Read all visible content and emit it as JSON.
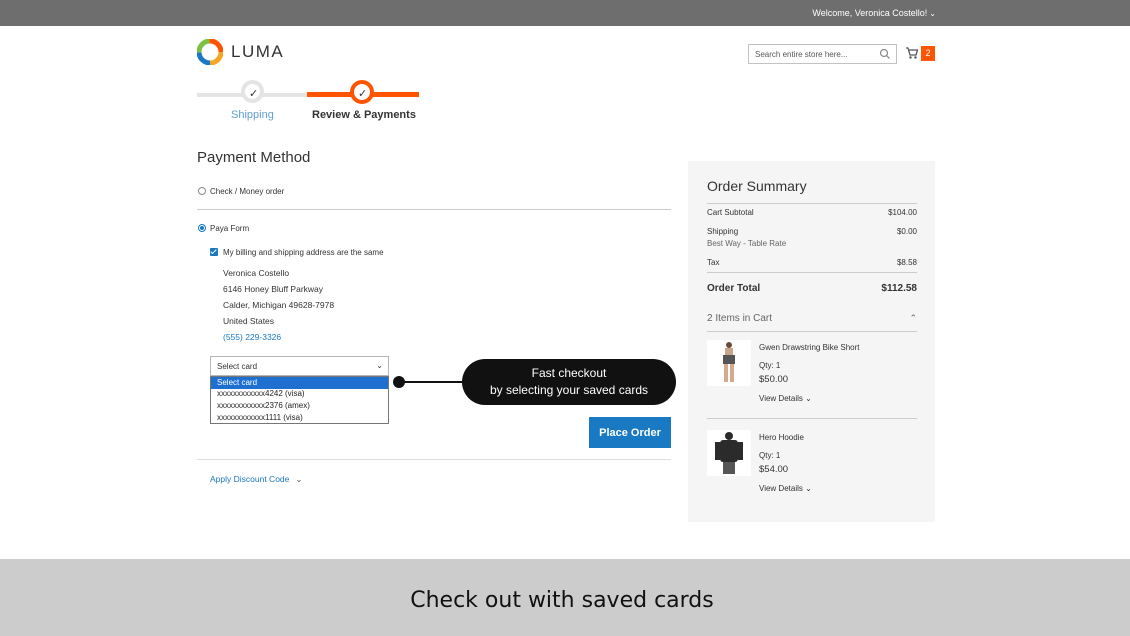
{
  "header": {
    "welcome": "Welcome, Veronica Costello!",
    "logo_text": "LUMA",
    "search_placeholder": "Search entire store here...",
    "cart_count": "2"
  },
  "progress": {
    "steps": [
      {
        "label": "Shipping"
      },
      {
        "label": "Review & Payments"
      }
    ]
  },
  "payment": {
    "title": "Payment Method",
    "methods": [
      {
        "label": "Check / Money order",
        "checked": false
      },
      {
        "label": "Paya Form",
        "checked": true
      }
    ],
    "same_address_label": "My billing and shipping address are the same",
    "address": [
      "Veronica Costello",
      "6146 Honey Bluff Parkway",
      "Calder, Michigan 49628-7978",
      "United States"
    ],
    "phone": "(555) 229-3326",
    "select_value": "Select card",
    "card_options": [
      "Select card",
      "xxxxxxxxxxxx4242 (visa)",
      "xxxxxxxxxxxx2376 (amex)",
      "xxxxxxxxxxxx1111 (visa)"
    ],
    "place_order": "Place Order",
    "discount_label": "Apply Discount Code"
  },
  "callout": {
    "line1": "Fast checkout",
    "line2": "by selecting your saved cards"
  },
  "summary": {
    "title": "Order Summary",
    "subtotal_label": "Cart Subtotal",
    "subtotal": "$104.00",
    "shipping_label": "Shipping",
    "shipping_method": "Best Way - Table Rate",
    "shipping": "$0.00",
    "tax_label": "Tax",
    "tax": "$8.58",
    "total_label": "Order Total",
    "total": "$112.58",
    "items_label": "2 Items in Cart",
    "items": [
      {
        "name": "Gwen Drawstring Bike Short",
        "qty": "Qty: 1",
        "price": "$50.00",
        "details": "View Details"
      },
      {
        "name": "Hero Hoodie",
        "qty": "Qty: 1",
        "price": "$54.00",
        "details": "View Details"
      }
    ]
  },
  "caption": "Check out with saved cards",
  "colors": {
    "accent": "#1979c3",
    "brand_orange": "#ff5501",
    "topbar": "#6e6e6e"
  }
}
